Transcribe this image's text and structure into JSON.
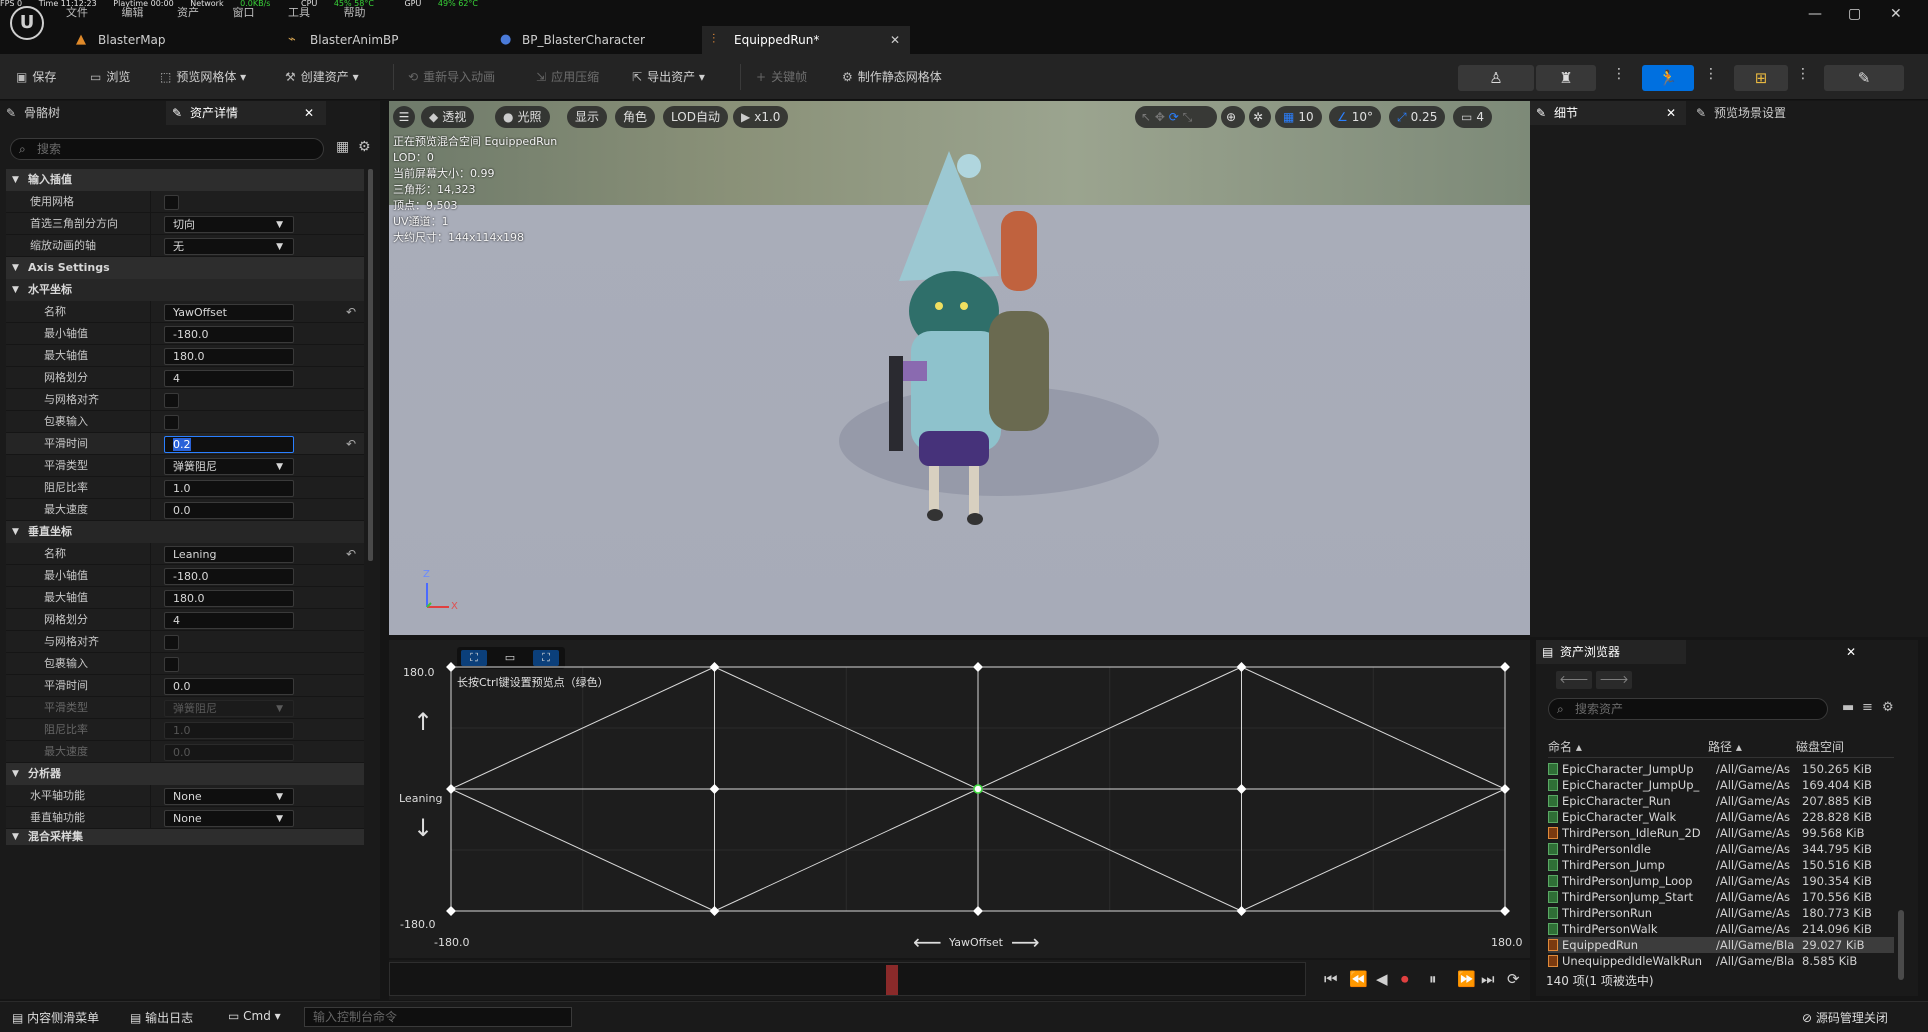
{
  "stats": {
    "fps": "FPS 0",
    "time": "Time 11:12:23",
    "playtime": "Playtime 00:00",
    "network": "Network",
    "network_val": "0.0KB/s",
    "cpu": "CPU",
    "cpu_val": "45% 58°C",
    "gpu": "GPU",
    "gpu_val": "49% 62°C"
  },
  "menu": [
    "文件",
    "编辑",
    "资产",
    "窗口",
    "工具",
    "帮助"
  ],
  "tabs": [
    {
      "label": "BlasterMap",
      "icon": "map-icon"
    },
    {
      "label": "BlasterAnimBP",
      "icon": "anim-blueprint-icon"
    },
    {
      "label": "BP_BlasterCharacter",
      "icon": "character-icon"
    },
    {
      "label": "EquippedRun*",
      "icon": "blendspace-icon",
      "active": true
    }
  ],
  "window_controls": {
    "minimize": "—",
    "maximize": "▢",
    "close": "✕"
  },
  "toolbar": {
    "save": "保存",
    "browse": "浏览",
    "preview_mesh": "预览网格体",
    "create_asset": "创建资产",
    "reimport": "重新导入动画",
    "apply_compression": "应用压缩",
    "export_asset": "导出资产",
    "key": "关键帧",
    "make_static_mesh": "制作静态网格体"
  },
  "left_panel": {
    "tab_skeleton": "骨骼树",
    "tab_details": "资产详情",
    "search_placeholder": "搜索",
    "cat_input": "输入插值",
    "use_grid": "使用网格",
    "tri_dir": "首选三角剖分方向",
    "tri_dir_val": "切向",
    "scale_axis": "缩放动画的轴",
    "scale_axis_val": "无",
    "cat_axis": "Axis Settings",
    "cat_h": "水平坐标",
    "h_name": "名称",
    "h_name_val": "YawOffset",
    "h_min": "最小轴值",
    "h_min_val": "-180.0",
    "h_max": "最大轴值",
    "h_max_val": "180.0",
    "h_div": "网格划分",
    "h_div_val": "4",
    "h_snap": "与网格对齐",
    "h_wrap": "包裹输入",
    "h_smooth": "平滑时间",
    "h_smooth_val": "0.2",
    "h_smooth_type": "平滑类型",
    "h_smooth_type_val": "弹簧阻尼",
    "h_damp": "阻尼比率",
    "h_damp_val": "1.0",
    "h_maxspeed": "最大速度",
    "h_maxspeed_val": "0.0",
    "cat_v": "垂直坐标",
    "v_name": "名称",
    "v_name_val": "Leaning",
    "v_min": "最小轴值",
    "v_min_val": "-180.0",
    "v_max": "最大轴值",
    "v_max_val": "180.0",
    "v_div": "网格划分",
    "v_div_val": "4",
    "v_snap": "与网格对齐",
    "v_wrap": "包裹输入",
    "v_smooth": "平滑时间",
    "v_smooth_val": "0.0",
    "v_smooth_type": "平滑类型",
    "v_smooth_type_val": "弹簧阻尼",
    "v_damp": "阻尼比率",
    "v_damp_val": "1.0",
    "v_maxspeed": "最大速度",
    "v_maxspeed_val": "0.0",
    "cat_analysis": "分析器",
    "h_func": "水平轴功能",
    "h_func_val": "None",
    "v_func": "垂直轴功能",
    "v_func_val": "None",
    "cat_sampling": "混合采样集"
  },
  "viewport": {
    "perspective": "透视",
    "lit": "光照",
    "show": "显示",
    "character": "角色",
    "lod": "LOD自动",
    "play_rate": "x1.0",
    "grid_snap": "10",
    "rot_snap": "10°",
    "scale_snap": "0.25",
    "cam_speed": "4",
    "info": [
      "正在预览混合空间 EquippedRun",
      "LOD：0",
      "当前屏幕大小：0.99",
      "三角形：14,323",
      "顶点：9,503",
      "UV通道：1",
      "大约尺寸：144x114x198"
    ],
    "axis_z": "Z",
    "axis_x": "X"
  },
  "right_panel": {
    "tab_details": "细节",
    "tab_preview": "预览场景设置"
  },
  "blendspace": {
    "hint": "长按Ctrl键设置预览点（绿色）",
    "y_max": "180.0",
    "y_min": "-180.0",
    "y_label": "Leaning",
    "x_min": "-180.0",
    "x_max": "180.0",
    "x_label": "YawOffset",
    "arrow_up": "↑",
    "arrow_down": "↓",
    "arrow_left": "⟵",
    "arrow_right": "⟶"
  },
  "content_browser": {
    "tab": "资产浏览器",
    "search_placeholder": "搜索资产",
    "col_name": "命名",
    "col_path": "路径",
    "col_size": "磁盘空间",
    "items": [
      {
        "name": "EpicCharacter_JumpUp",
        "path": "/All/Game/As",
        "size": "150.265 KiB",
        "type": "anim"
      },
      {
        "name": "EpicCharacter_JumpUp_",
        "path": "/All/Game/As",
        "size": "169.404 KiB",
        "type": "anim"
      },
      {
        "name": "EpicCharacter_Run",
        "path": "/All/Game/As",
        "size": "207.885 KiB",
        "type": "anim"
      },
      {
        "name": "EpicCharacter_Walk",
        "path": "/All/Game/As",
        "size": "228.828 KiB",
        "type": "anim"
      },
      {
        "name": "ThirdPerson_IdleRun_2D",
        "path": "/All/Game/As",
        "size": "99.568 KiB",
        "type": "blend"
      },
      {
        "name": "ThirdPersonIdle",
        "path": "/All/Game/As",
        "size": "344.795 KiB",
        "type": "anim"
      },
      {
        "name": "ThirdPerson_Jump",
        "path": "/All/Game/As",
        "size": "150.516 KiB",
        "type": "anim"
      },
      {
        "name": "ThirdPersonJump_Loop",
        "path": "/All/Game/As",
        "size": "190.354 KiB",
        "type": "anim"
      },
      {
        "name": "ThirdPersonJump_Start",
        "path": "/All/Game/As",
        "size": "170.556 KiB",
        "type": "anim"
      },
      {
        "name": "ThirdPersonRun",
        "path": "/All/Game/As",
        "size": "180.773 KiB",
        "type": "anim"
      },
      {
        "name": "ThirdPersonWalk",
        "path": "/All/Game/As",
        "size": "214.096 KiB",
        "type": "anim"
      },
      {
        "name": "EquippedRun",
        "path": "/All/Game/Bla",
        "size": "29.027 KiB",
        "type": "blend",
        "selected": true
      },
      {
        "name": "UnequippedIdleWalkRun",
        "path": "/All/Game/Bla",
        "size": "8.585 KiB",
        "type": "blend"
      }
    ],
    "footer": "140 项(1 项被选中)"
  },
  "statusbar": {
    "content_drawer": "内容侧滑菜单",
    "output_log": "输出日志",
    "cmd": "Cmd",
    "console_placeholder": "输入控制台命令",
    "source_control": "源码管理关闭"
  }
}
